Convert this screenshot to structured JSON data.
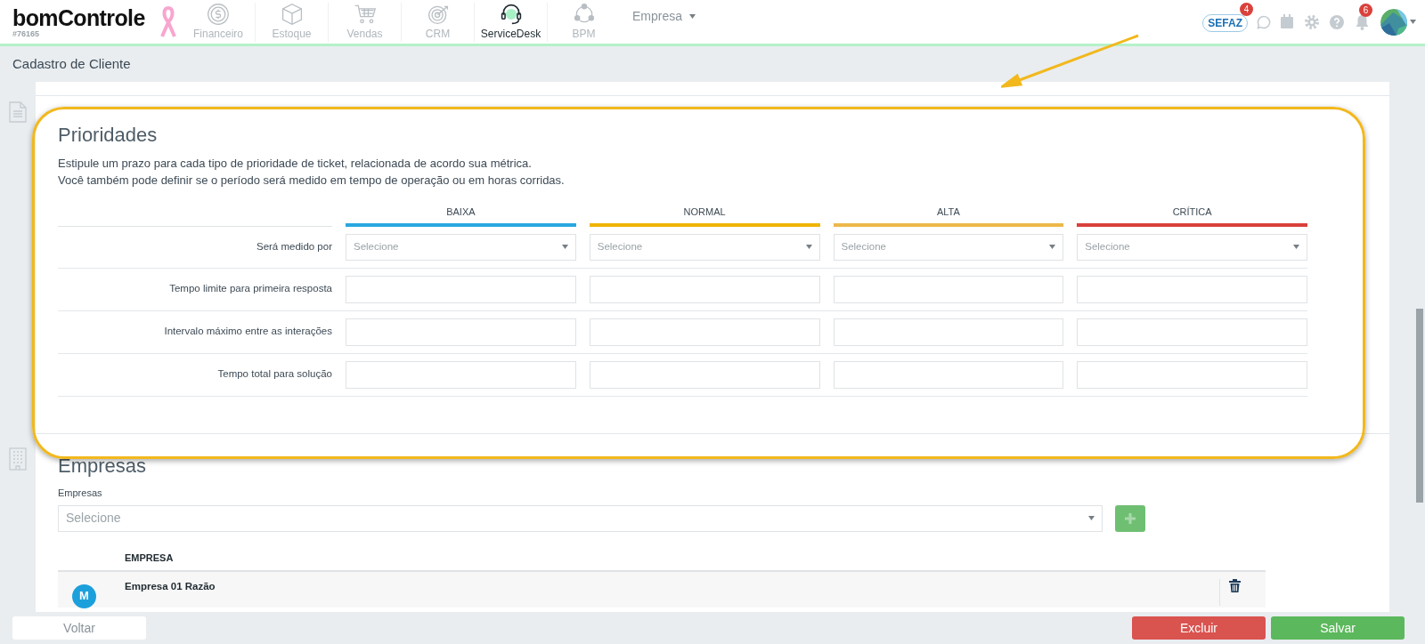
{
  "header": {
    "logo": "bomControle",
    "account": "#76165",
    "modules": [
      {
        "label": "Financeiro",
        "kind": "money",
        "selected": false
      },
      {
        "label": "Estoque",
        "kind": "box",
        "selected": false
      },
      {
        "label": "Vendas",
        "kind": "cart",
        "selected": false
      },
      {
        "label": "CRM",
        "kind": "target",
        "selected": false
      },
      {
        "label": "ServiceDesk",
        "kind": "headset",
        "selected": true
      },
      {
        "label": "BPM",
        "kind": "cycle",
        "selected": false
      }
    ],
    "company_menu": "Empresa",
    "sefaz": {
      "label": "SEFAZ",
      "badge": "4"
    },
    "notifications_badge": "6"
  },
  "page_title": "Cadastro de Cliente",
  "priorities": {
    "title": "Prioridades",
    "description": [
      "Estipule um prazo para cada tipo de prioridade de ticket, relacionada de acordo sua métrica.",
      "Você também pode definir se o período será medido em tempo de operação ou em horas corridas."
    ],
    "columns": [
      {
        "label": "BAIXA",
        "color": "#29a8e0"
      },
      {
        "label": "NORMAL",
        "color": "#f0b400"
      },
      {
        "label": "ALTA",
        "color": "#ecb84a"
      },
      {
        "label": "CRÍTICA",
        "color": "#d9413b"
      }
    ],
    "rows": [
      {
        "label": "Será medido por",
        "kind": "select",
        "placeholders": [
          "Selecione",
          "Selecione",
          "Selecione",
          "Selecione"
        ]
      },
      {
        "label": "Tempo limite para primeira resposta",
        "kind": "input"
      },
      {
        "label": "Intervalo máximo entre as interações",
        "kind": "input"
      },
      {
        "label": "Tempo total para solução",
        "kind": "input"
      }
    ]
  },
  "companies": {
    "title": "Empresas",
    "field_label": "Empresas",
    "placeholder": "Selecione",
    "table": {
      "columns": [
        "EMPRESA"
      ],
      "rows": [
        {
          "avatar": "M",
          "name": "Empresa 01 Razão"
        }
      ]
    }
  },
  "footer": {
    "back": "Voltar",
    "delete": "Excluir",
    "save": "Salvar"
  }
}
